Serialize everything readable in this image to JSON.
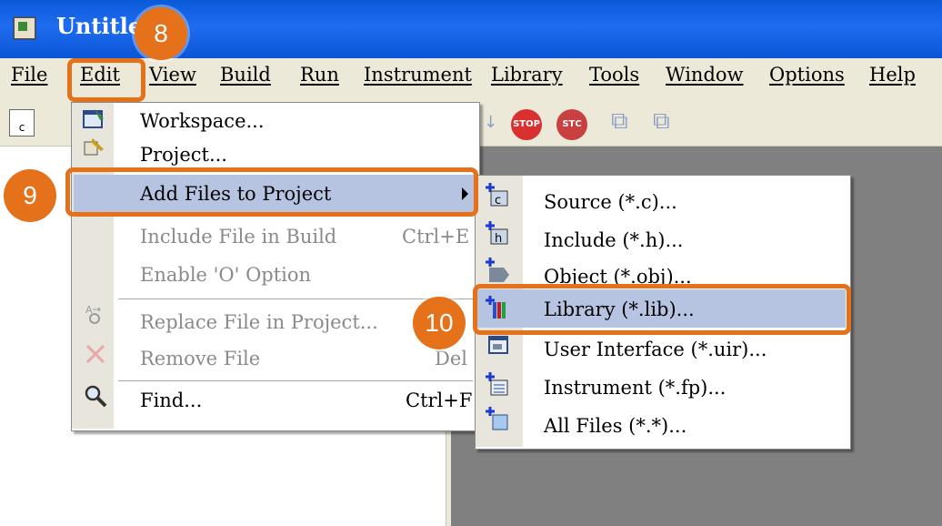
{
  "window": {
    "title": "Untitle"
  },
  "menubar": [
    {
      "label": "File"
    },
    {
      "label": "Edit"
    },
    {
      "label": "View"
    },
    {
      "label": "Build"
    },
    {
      "label": "Run"
    },
    {
      "label": "Instrument"
    },
    {
      "label": "Library"
    },
    {
      "label": "Tools"
    },
    {
      "label": "Window"
    },
    {
      "label": "Options"
    },
    {
      "label": "Help"
    }
  ],
  "toolbar": {
    "new_c_label": "c",
    "stop_label": "STOP",
    "stop2_label": "STC"
  },
  "edit_menu": {
    "items": [
      {
        "label": "Workspace...",
        "shortcut": ""
      },
      {
        "label": "Project...",
        "shortcut": ""
      },
      {
        "label": "Add Files to Project",
        "shortcut": ""
      },
      {
        "label": "Include File in Build",
        "shortcut": "Ctrl+E"
      },
      {
        "label": "Enable 'O' Option",
        "shortcut": ""
      },
      {
        "label": "Replace File in Project...",
        "shortcut": ""
      },
      {
        "label": "Remove File",
        "shortcut": "Del"
      },
      {
        "label": "Find...",
        "shortcut": "Ctrl+F"
      }
    ]
  },
  "add_files_submenu": {
    "items": [
      {
        "label": "Source (*.c)...",
        "icon_text": "c"
      },
      {
        "label": "Include (*.h)...",
        "icon_text": "h"
      },
      {
        "label": "Object (*.obj)..."
      },
      {
        "label": "Library (*.lib)..."
      },
      {
        "label": "User Interface (*.uir)..."
      },
      {
        "label": "Instrument (*.fp)..."
      },
      {
        "label": "All Files (*.*)..."
      }
    ]
  },
  "annotations": {
    "step8": "8",
    "step9": "9",
    "step10": "10"
  },
  "colors": {
    "callout": "#e5711a",
    "highlight": "#b6c4e2",
    "titlebar": "#0a5ad8"
  }
}
